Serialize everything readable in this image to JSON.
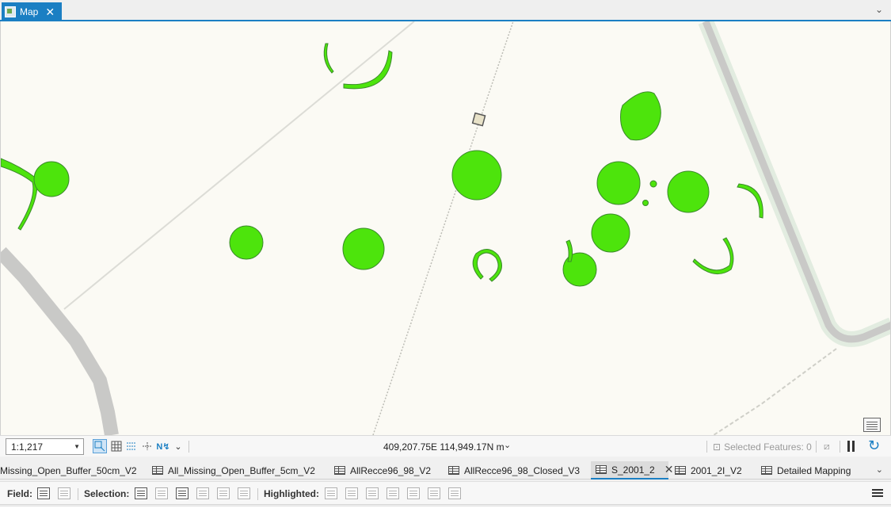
{
  "tab": {
    "label": "Map"
  },
  "map": {
    "colors": {
      "background": "#fbfaf4",
      "feature": "#4de40c",
      "feature_stroke": "#3a8a2a",
      "road": "#c9c9c7",
      "road_edge": "#e4efe0"
    }
  },
  "status": {
    "scale": "1:1,217",
    "coordinates": "409,207.75E 114,949.17N m",
    "selected_features": "Selected Features: 0"
  },
  "table_tabs": [
    {
      "label": "Missing_Open_Buffer_50cm_V2"
    },
    {
      "label": "All_Missing_Open_Buffer_5cm_V2"
    },
    {
      "label": "AllRecce96_98_V2"
    },
    {
      "label": "AllRecce96_98_Closed_V3"
    },
    {
      "label": "S_2001_2",
      "active": true
    },
    {
      "label": "2001_2I_V2"
    },
    {
      "label": "Detailed Mapping"
    }
  ],
  "attr_toolbar": {
    "field_label": "Field:",
    "selection_label": "Selection:",
    "highlighted_label": "Highlighted:"
  }
}
